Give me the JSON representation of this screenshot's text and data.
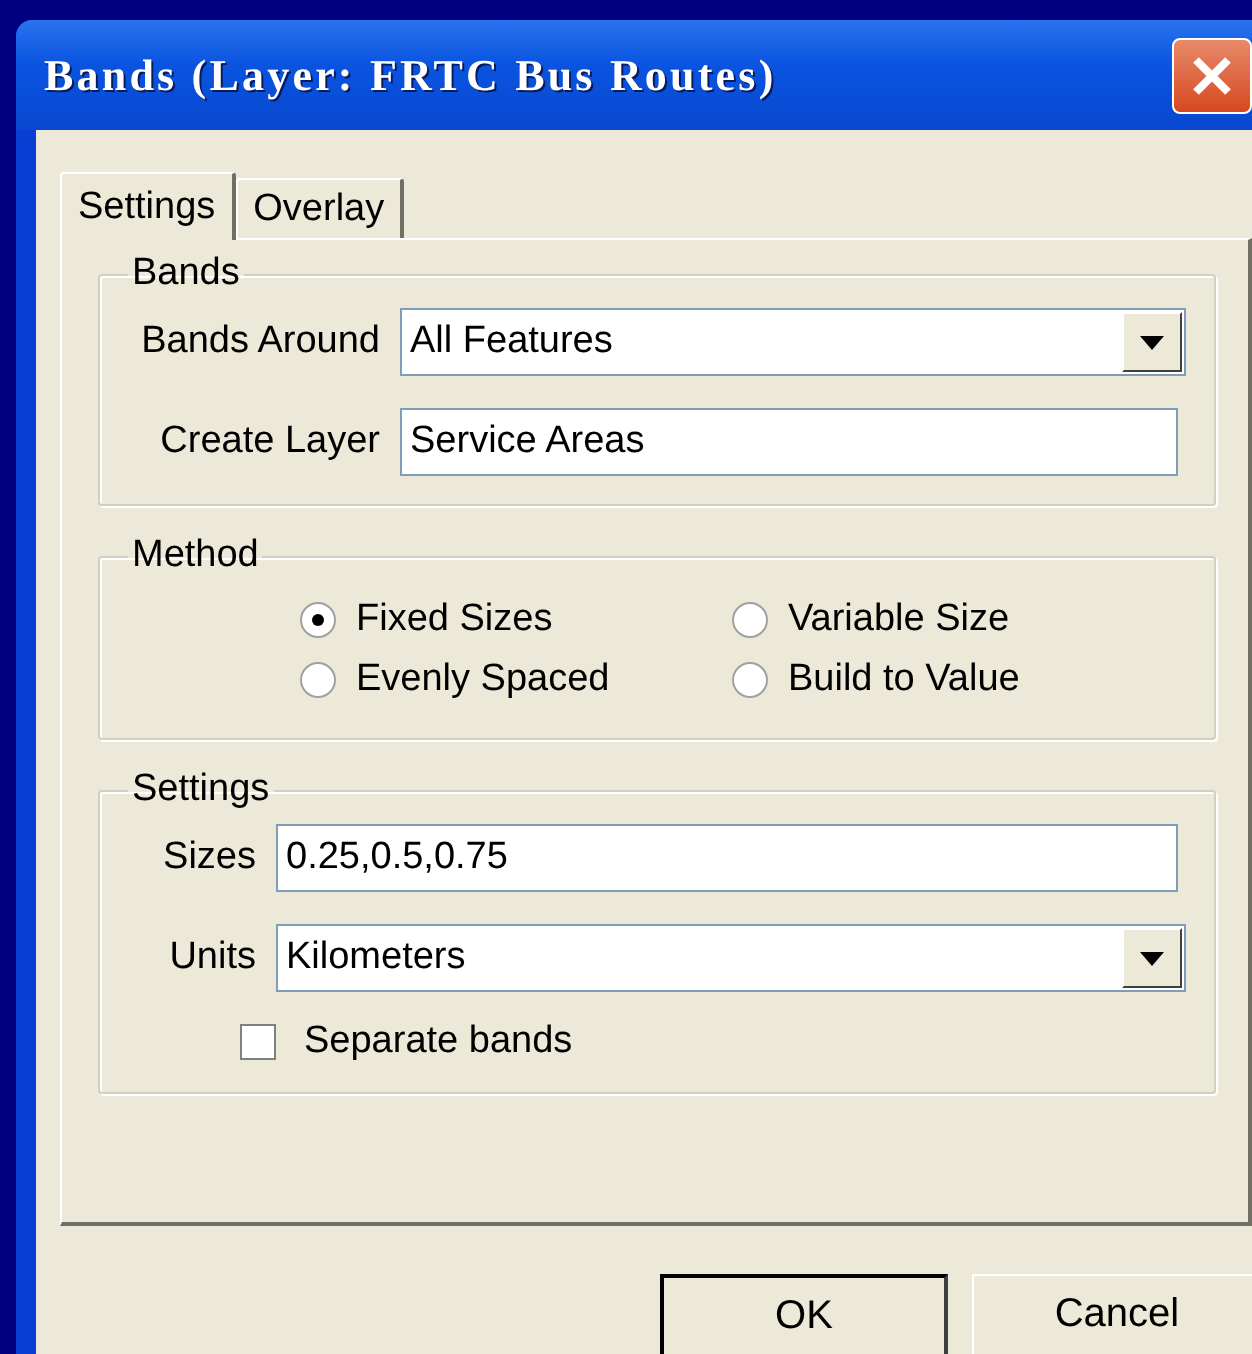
{
  "window": {
    "title": "Bands (Layer: FRTC Bus Routes)"
  },
  "tabs": [
    {
      "label": "Settings",
      "selected": true
    },
    {
      "label": "Overlay",
      "selected": false
    }
  ],
  "groups": [
    {
      "title": "Bands",
      "kind": "fields",
      "items": [
        {
          "kind": "dropdown",
          "label": "Bands Around",
          "value": "All Features"
        },
        {
          "kind": "text",
          "label": "Create Layer",
          "value": "Service Areas"
        }
      ]
    },
    {
      "title": "Method",
      "kind": "radios",
      "items": [
        {
          "label": "Fixed Sizes",
          "selected": true
        },
        {
          "label": "Variable Size",
          "selected": false
        },
        {
          "label": "Evenly Spaced",
          "selected": false
        },
        {
          "label": "Build to Value",
          "selected": false
        }
      ]
    },
    {
      "title": "Settings",
      "kind": "fields",
      "items": [
        {
          "kind": "text",
          "label": "Sizes",
          "value": "0.25,0.5,0.75"
        },
        {
          "kind": "dropdown",
          "label": "Units",
          "value": "Kilometers"
        },
        {
          "kind": "checkbox",
          "label": "Separate bands",
          "checked": false
        }
      ]
    }
  ],
  "buttons": [
    {
      "label": "OK",
      "default": true
    },
    {
      "label": "Cancel",
      "default": false
    }
  ]
}
